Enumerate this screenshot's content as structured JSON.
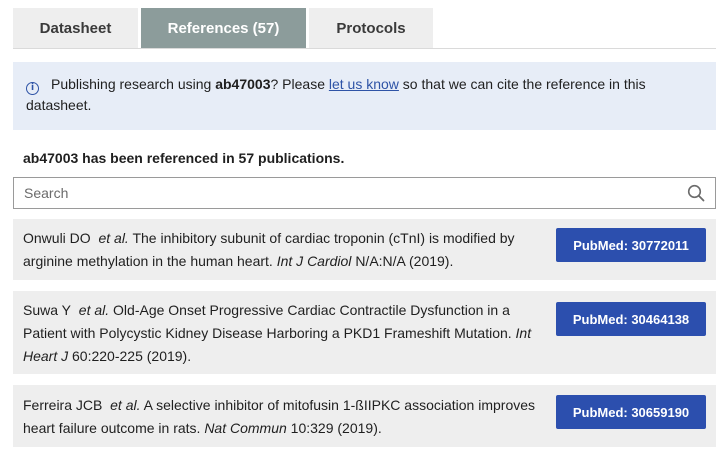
{
  "tabs": [
    {
      "label": "Datasheet",
      "active": false
    },
    {
      "label": "References (57)",
      "active": true
    },
    {
      "label": "Protocols",
      "active": false
    }
  ],
  "notice": {
    "icon": "info-icon",
    "prefix": "Publishing research using ",
    "product": "ab47003",
    "middle": "? Please ",
    "link_text": "let us know",
    "suffix": " so that we can cite the reference in this datasheet."
  },
  "summary": "ab47003 has been referenced in 57 publications.",
  "search": {
    "placeholder": "Search",
    "value": "",
    "icon": "search-icon"
  },
  "references": [
    {
      "authors": "Onwuli DO",
      "etal": "et al.",
      "title": "The inhibitory subunit of cardiac troponin (cTnI) is modified by arginine methylation in the human heart.",
      "journal": "Int J Cardiol",
      "details": "N/A:N/A (2019).",
      "pubmed": "PubMed: 30772011"
    },
    {
      "authors": "Suwa Y",
      "etal": "et al.",
      "title": "Old-Age Onset Progressive Cardiac Contractile Dysfunction in a Patient with Polycystic Kidney Disease Harboring a PKD1 Frameshift Mutation.",
      "journal": "Int Heart J",
      "details": "60:220-225 (2019).",
      "pubmed": "PubMed: 30464138"
    },
    {
      "authors": "Ferreira JCB",
      "etal": "et al.",
      "title": "A selective inhibitor of mitofusin 1-ßIIPKC association improves heart failure outcome in rats.",
      "journal": "Nat Commun",
      "details": "10:329 (2019).",
      "pubmed": "PubMed: 30659190"
    }
  ],
  "colors": {
    "active_tab": "#8c9c9b",
    "notice_bg": "#e7edf7",
    "link": "#2e53a6",
    "pubmed_button": "#2c4fae",
    "row_bg": "#eeeeee"
  }
}
